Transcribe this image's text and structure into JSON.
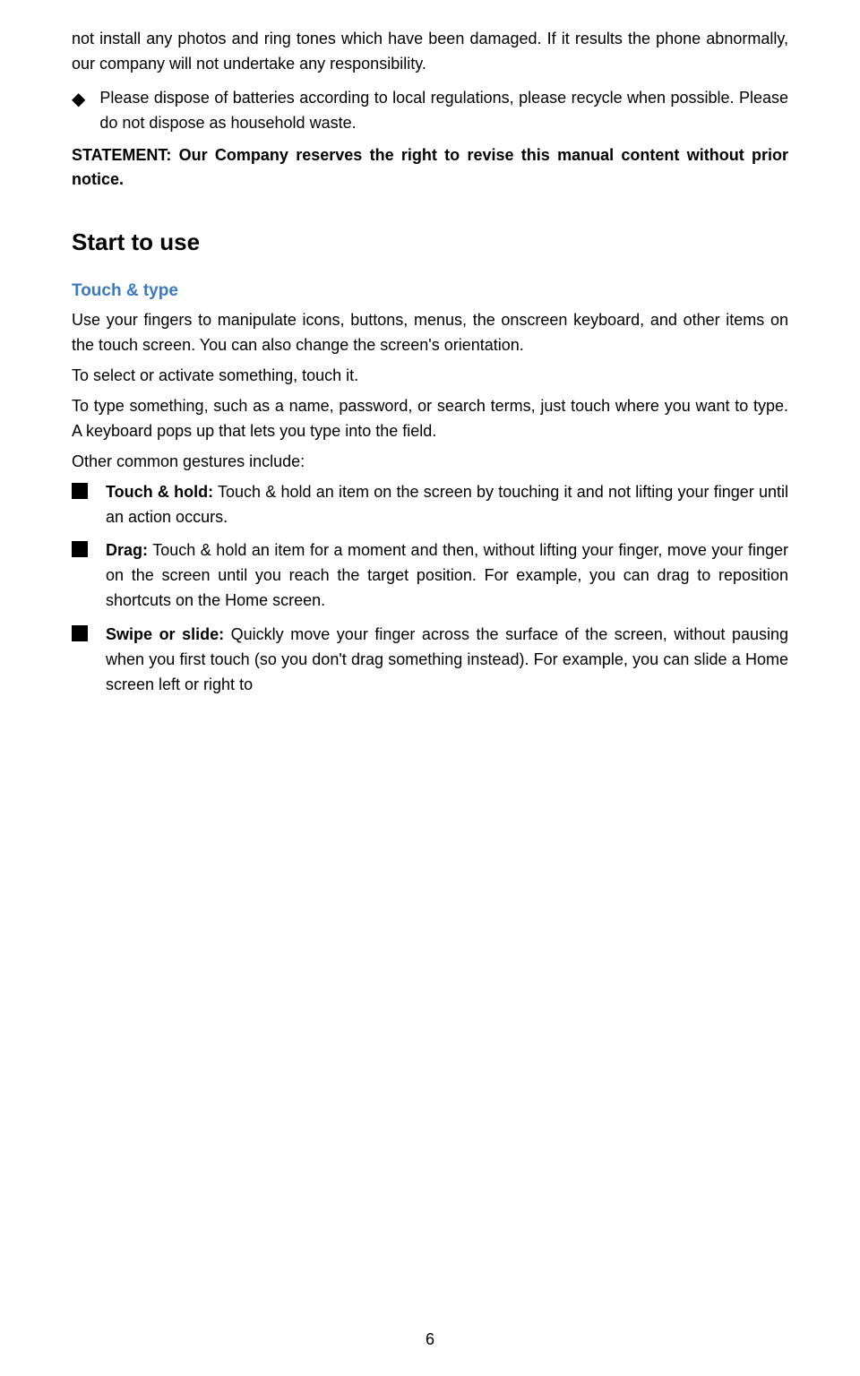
{
  "top": {
    "para1": "not install any photos and ring tones which have been damaged. If it results the phone abnormally, our company will not undertake any responsibility.",
    "bullet1": "Please dispose of batteries according to local regulations, please recycle when possible. Please do not dispose as household waste.",
    "statement": "STATEMENT: Our Company reserves the right to revise this manual content without prior notice.",
    "statement_bold_part": "STATEMENT: Our Company reserves the right to revise this manual content without prior notice."
  },
  "start_to_use": {
    "heading": "Start to use",
    "subsection_heading": "Touch & type",
    "para1": "Use your fingers to manipulate icons, buttons, menus, the onscreen keyboard, and other items on the touch screen. You can also change the screen's orientation.",
    "para2": "To select or activate something, touch it.",
    "para3": "To type something, such as a name, password, or search terms, just touch where you want to type. A keyboard pops up that lets you type into the field.",
    "para4": "Other common gestures include:",
    "bullets": [
      {
        "label": "Touch & hold:",
        "text": " Touch & hold an item on the screen by touching it and not lifting your finger until an action occurs."
      },
      {
        "label": "Drag:",
        "text": " Touch & hold an item for a moment and then, without lifting your finger, move your finger on the screen until you reach the target position. For example, you can drag to reposition shortcuts on the Home screen."
      },
      {
        "label": "Swipe or slide:",
        "text": " Quickly move your finger across the surface of the screen, without pausing when you first touch (so you don't drag something instead). For example, you can slide a Home screen left or right to"
      }
    ]
  },
  "page_number": "6",
  "colors": {
    "blue_heading": "#3a7abf",
    "black": "#000000",
    "white": "#ffffff"
  }
}
